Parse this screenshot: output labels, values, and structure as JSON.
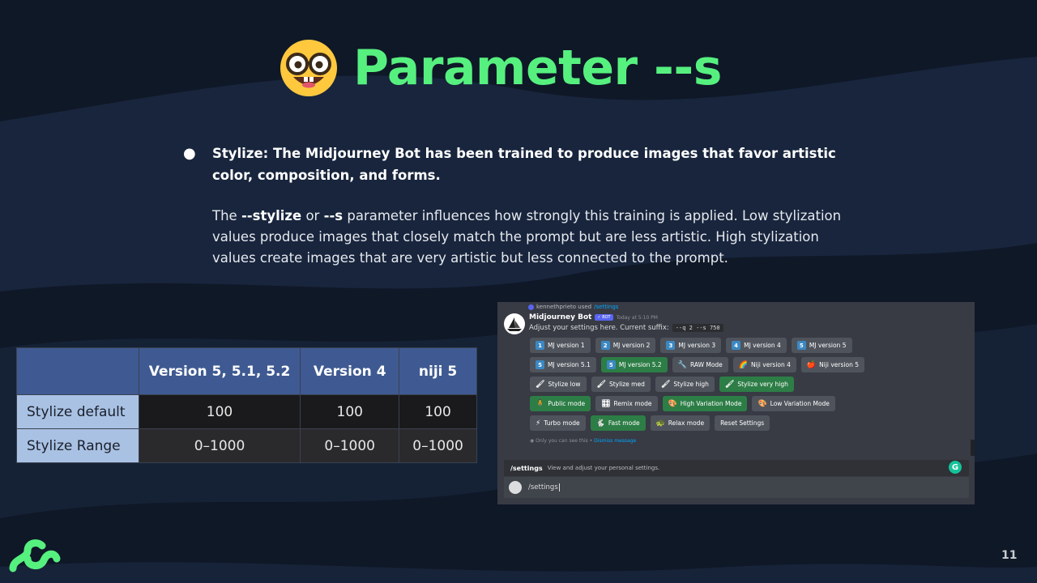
{
  "title": {
    "emoji_icon": "nerd-face-icon",
    "text": "Parameter --s"
  },
  "content": {
    "bullet_heading": "Stylize: The Midjourney Bot has been trained to produce images that favor artistic color, composition, and forms.",
    "para_pre": "The ",
    "para_b1": "--stylize",
    "para_mid": " or ",
    "para_b2": "--s",
    "para_post": " parameter influences how strongly this training is applied. Low stylization values produce images that closely match the prompt but are less artistic. High stylization values create images that are very artistic but less connected to the prompt."
  },
  "table": {
    "headers": [
      "",
      "Version 5, 5.1, 5.2",
      "Version 4",
      "niji 5"
    ],
    "rows": [
      {
        "label": "Stylize default",
        "values": [
          "100",
          "100",
          "100"
        ]
      },
      {
        "label": "Stylize Range",
        "values": [
          "0–1000",
          "0–1000",
          "0–1000"
        ]
      }
    ]
  },
  "discord": {
    "reply_user": "kennethprieto used",
    "reply_cmd": "/settings",
    "bot_name": "Midjourney Bot",
    "bot_badge": "✓ BOT",
    "timestamp": "Today at 5:10 PM",
    "message": "Adjust your settings here. Current suffix:",
    "suffix_code": "--q 2 --s 750",
    "button_rows": [
      [
        {
          "label": "MJ version 1",
          "icon": "1",
          "style": "gray"
        },
        {
          "label": "MJ version 2",
          "icon": "2",
          "style": "gray"
        },
        {
          "label": "MJ version 3",
          "icon": "3",
          "style": "gray"
        },
        {
          "label": "MJ version 4",
          "icon": "4",
          "style": "gray"
        },
        {
          "label": "MJ version 5",
          "icon": "5",
          "style": "gray"
        }
      ],
      [
        {
          "label": "MJ version 5.1",
          "icon": "5",
          "style": "gray"
        },
        {
          "label": "MJ version 5.2",
          "icon": "5",
          "style": "green"
        },
        {
          "label": "RAW Mode",
          "icon": "🔧",
          "style": "gray"
        },
        {
          "label": "Niji version 4",
          "icon": "🌈",
          "style": "gray"
        },
        {
          "label": "Niji version 5",
          "icon": "🍎",
          "style": "gray"
        }
      ],
      [
        {
          "label": "Stylize low",
          "icon": "🖌",
          "style": "gray"
        },
        {
          "label": "Stylize med",
          "icon": "🖌",
          "style": "gray"
        },
        {
          "label": "Stylize high",
          "icon": "🖌",
          "style": "gray"
        },
        {
          "label": "Stylize very high",
          "icon": "🖌",
          "style": "green"
        }
      ],
      [
        {
          "label": "Public mode",
          "icon": "🧍",
          "style": "green"
        },
        {
          "label": "Remix mode",
          "icon": "🎛",
          "style": "gray"
        },
        {
          "label": "High Variation Mode",
          "icon": "🎨",
          "style": "green"
        },
        {
          "label": "Low Variation Mode",
          "icon": "🎨",
          "style": "gray"
        }
      ],
      [
        {
          "label": "Turbo mode",
          "icon": "⚡",
          "style": "gray"
        },
        {
          "label": "Fast mode",
          "icon": "🐇",
          "style": "green"
        },
        {
          "label": "Relax mode",
          "icon": "🐢",
          "style": "gray"
        },
        {
          "label": "Reset Settings",
          "icon": "",
          "style": "gray"
        }
      ]
    ],
    "ephemeral_text": "Only you can see this •",
    "dismiss_text": "Dismiss message",
    "cmd_name": "/settings",
    "cmd_desc": "View and adjust your personal settings.",
    "input_value": "/settings"
  },
  "page_number": "11",
  "colors": {
    "title": "#56f07f",
    "background": "#0f1827",
    "table_header": "#3f5a92",
    "table_rowhead": "#a9c2e4",
    "discord_green": "#2d7d46",
    "discord_gray": "#4f545c"
  }
}
